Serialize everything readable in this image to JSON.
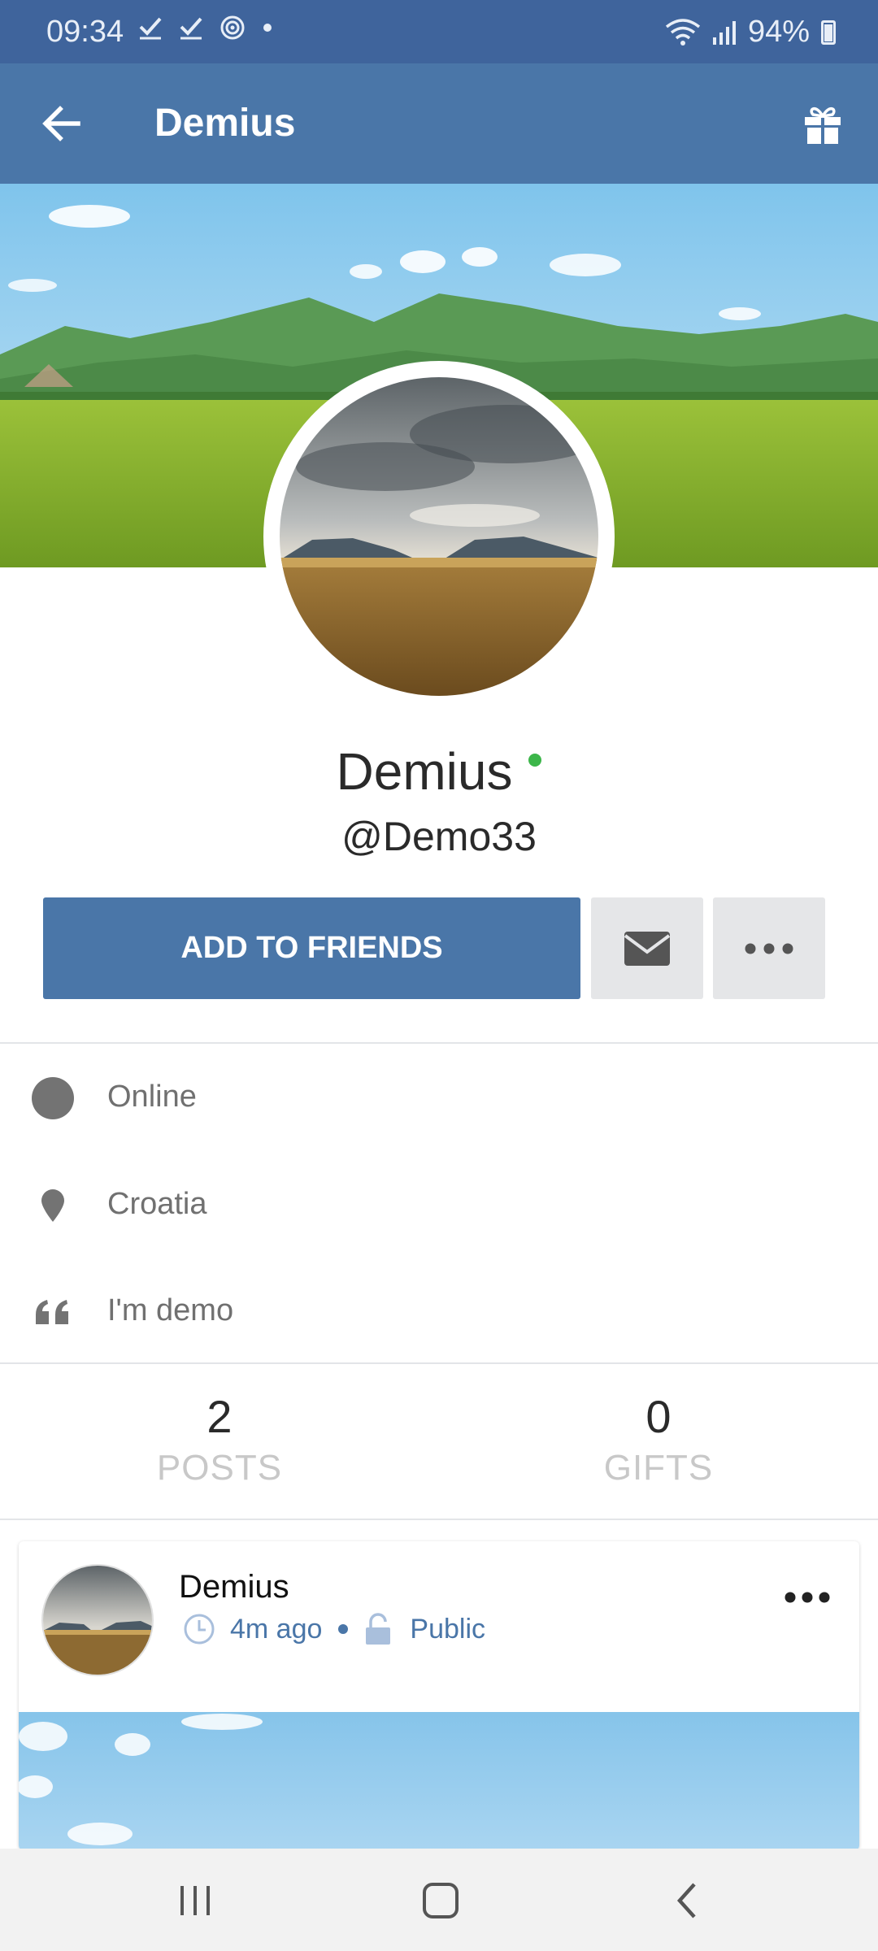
{
  "status_bar": {
    "time": "09:34",
    "battery": "94%",
    "icons": [
      "check-icon",
      "check-icon",
      "target-icon",
      "dot-icon",
      "wifi-icon",
      "signal-icon",
      "battery-icon"
    ]
  },
  "app_bar": {
    "title": "Demius",
    "back_icon": "arrow-left-icon",
    "gift_icon": "gift-icon"
  },
  "profile": {
    "name": "Demius",
    "handle": "@Demo33",
    "add_friends_label": "ADD TO FRIENDS"
  },
  "info": [
    {
      "icon": "circle-icon",
      "text": "Online"
    },
    {
      "icon": "location-pin-icon",
      "text": "Croatia"
    },
    {
      "icon": "quote-icon",
      "text": "I'm demo"
    }
  ],
  "stats": [
    {
      "value": "2",
      "label": "POSTS"
    },
    {
      "value": "0",
      "label": "GIFTS"
    }
  ],
  "post": {
    "author": "Demius",
    "time": "4m ago",
    "privacy": "Public"
  },
  "colors": {
    "status_bar": "#3f649c",
    "app_bar": "#4a76a8",
    "primary_button": "#4a76a8",
    "secondary_button": "#e5e6e8",
    "online": "#3cb64a",
    "meta": "#4a76a8"
  }
}
